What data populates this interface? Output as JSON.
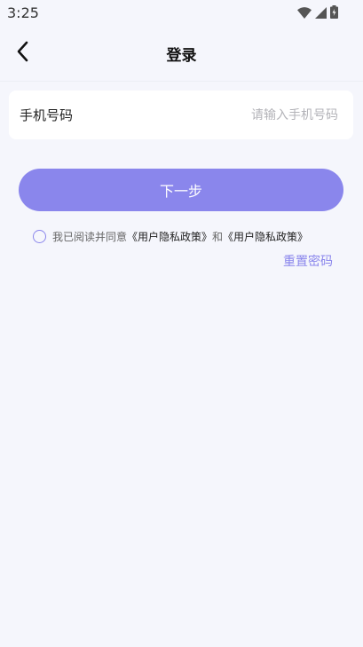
{
  "status_bar": {
    "time": "3:25",
    "icons": [
      "wifi-icon",
      "signal-icon",
      "battery-icon"
    ]
  },
  "nav": {
    "title": "登录",
    "back_icon": "chevron-left-icon"
  },
  "phone_field": {
    "label": "手机号码",
    "placeholder": "请输入手机号码",
    "value": ""
  },
  "next_button": {
    "label": "下一步"
  },
  "agreement": {
    "prefix": "我已阅读并同意",
    "link1": "《用户隐私政策》",
    "conjunction": "和",
    "link2": "《用户隐私政策》",
    "checked": false
  },
  "reset_password": {
    "label": "重置密码"
  },
  "colors": {
    "accent": "#8a86ec",
    "background": "#f5f6fc",
    "card": "#ffffff",
    "placeholder": "#b3b3b8"
  }
}
